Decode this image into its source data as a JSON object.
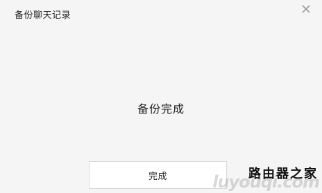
{
  "window": {
    "title": "备份聊天记录",
    "close_icon": "close-icon"
  },
  "main": {
    "status_text": "备份完成"
  },
  "footer": {
    "done_label": "完成"
  },
  "watermark": {
    "chinese": "路由器之家",
    "english": "luyouqi.com"
  },
  "colors": {
    "background": "#f5f5f5",
    "button_bg": "#ffffff",
    "button_border": "#d9d9d9",
    "text": "#222222",
    "close_icon": "#9a9a9a"
  }
}
